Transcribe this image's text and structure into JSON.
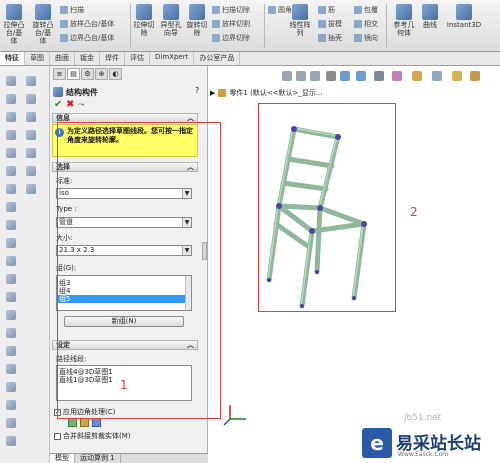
{
  "ribbon": {
    "buttons": [
      {
        "label": "拉伸凸\n台/基\n体"
      },
      {
        "label": "旋转凸\n台/基\n体"
      },
      {
        "label": "拉伸切\n除"
      },
      {
        "label": "异型孔\n向导"
      },
      {
        "label": "旋转切\n除"
      },
      {
        "label": "线性阵\n列"
      },
      {
        "label": "参考几\n何体"
      },
      {
        "label": "曲线"
      },
      {
        "label": "Instant3D"
      }
    ],
    "small_items": [
      {
        "label": "扫描"
      },
      {
        "label": "放样凸台/基体"
      },
      {
        "label": "边界凸台/基体"
      },
      {
        "label": "扫描切除"
      },
      {
        "label": "放样切割"
      },
      {
        "label": "边界切除"
      },
      {
        "label": "圆角"
      },
      {
        "label": "筋"
      },
      {
        "label": "拔模"
      },
      {
        "label": "抽壳"
      },
      {
        "label": "包覆"
      },
      {
        "label": "相交"
      },
      {
        "label": "镜向"
      }
    ]
  },
  "command_tabs": [
    "特征",
    "草图",
    "曲面",
    "钣金",
    "焊件",
    "评估",
    "DimXpert",
    "办公室产品"
  ],
  "property_manager": {
    "title": "结构构件",
    "help_icon": "?",
    "message_header": "信息",
    "message_text": "为定义路径选择草图线段。您可按一指定角度来旋转轮廓。",
    "selection_header": "选择",
    "standard_label": "标准:",
    "standard_value": "iso",
    "type_label": "Type :",
    "type_value": "管道",
    "size_label": "大小:",
    "size_value": "21.3 x 2.3",
    "groups_label": "组(G):",
    "groups": [
      "组3",
      "组4",
      "组5"
    ],
    "new_group_button": "新组(N)",
    "settings_header": "设定",
    "path_label": "路径线段:",
    "path_segments": [
      "直线4@3D草图1",
      "直线1@3D草图1"
    ],
    "corner_treatment": "应用边角处理(C)",
    "merge_label": "合并斜接剪裁实体(M)"
  },
  "tree_breadcrumb": "零件1  (默认<<默认>_显示...",
  "bottom_tabs": [
    "模型",
    "运动算例 1"
  ],
  "annotations": {
    "label1": "1",
    "label2": "2"
  },
  "watermark": {
    "site": "jb51.net",
    "brand": "易采站长站",
    "sub": "Www.Easck.Com"
  },
  "colors": {
    "annotation_red": "#e53b3b",
    "message_bg": "#ffff66",
    "selection_blue": "#3399ff",
    "tube_green": "#8fb89a"
  }
}
